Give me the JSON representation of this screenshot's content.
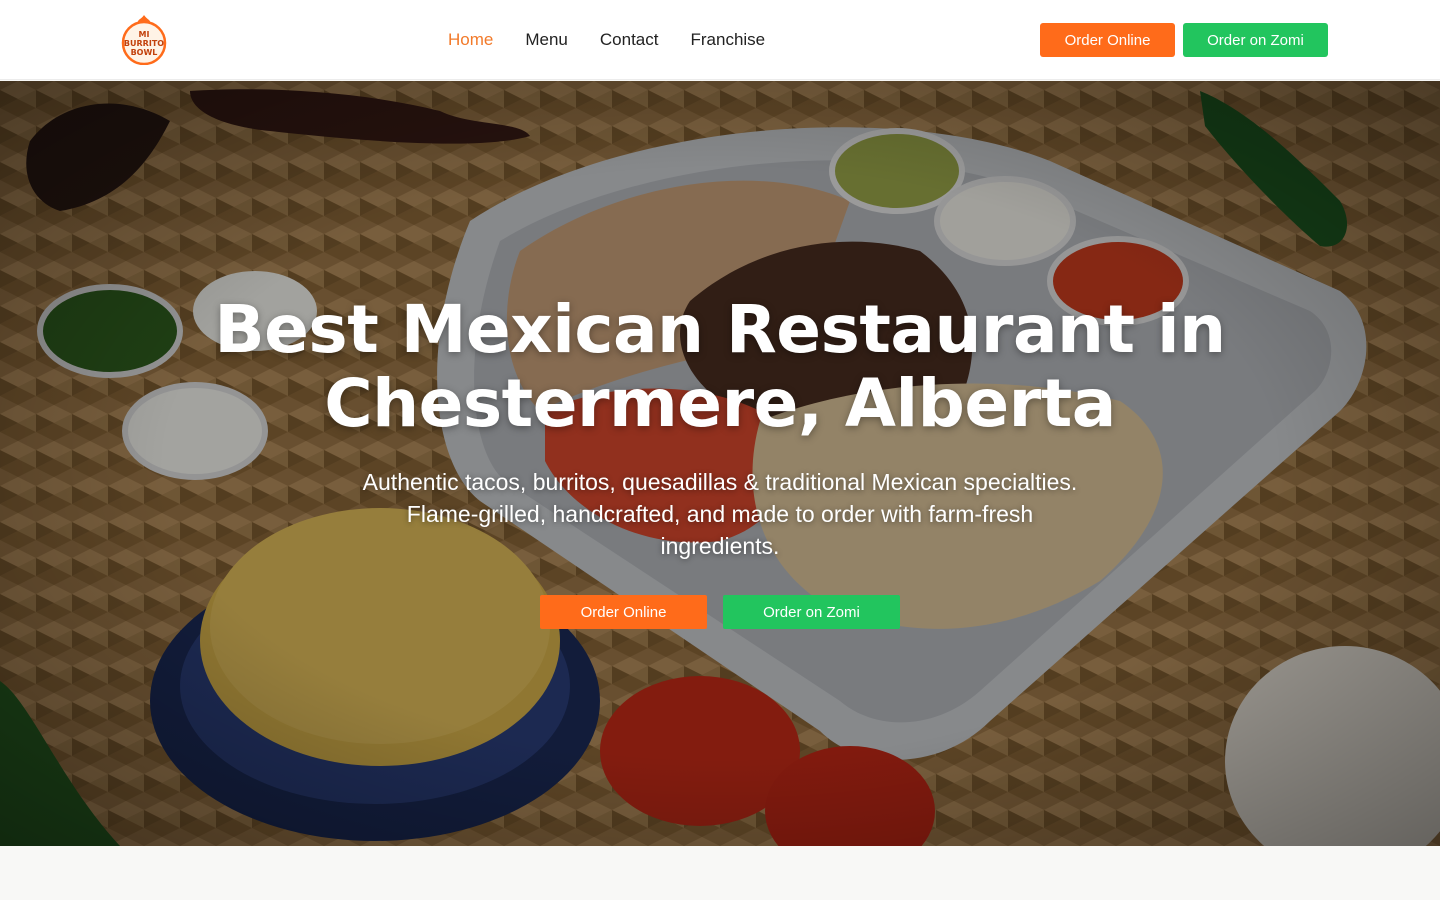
{
  "header": {
    "logo": {
      "line1": "MI",
      "line2": "BURRITO",
      "line3": "BOWL",
      "icon": "flame-bowl-logo"
    },
    "nav": [
      {
        "label": "Home",
        "active": true
      },
      {
        "label": "Menu",
        "active": false
      },
      {
        "label": "Contact",
        "active": false
      },
      {
        "label": "Franchise",
        "active": false
      }
    ],
    "order_online_label": "Order Online",
    "order_zomi_label": "Order on Zomi"
  },
  "hero": {
    "title_line1": "Best Mexican Restaurant in",
    "title_line2": "Chestermere, Alberta",
    "subtitle": "Authentic tacos, burritos, quesadillas & traditional Mexican specialties. Flame-grilled, handcrafted, and made to order with farm-fresh ingredients.",
    "order_online_label": "Order Online",
    "order_zomi_label": "Order on Zomi",
    "background": "mexican-food-platter-photo"
  },
  "colors": {
    "accent_orange": "#ff6b1a",
    "accent_green": "#22c55e",
    "active_nav": "#f27a2a"
  }
}
